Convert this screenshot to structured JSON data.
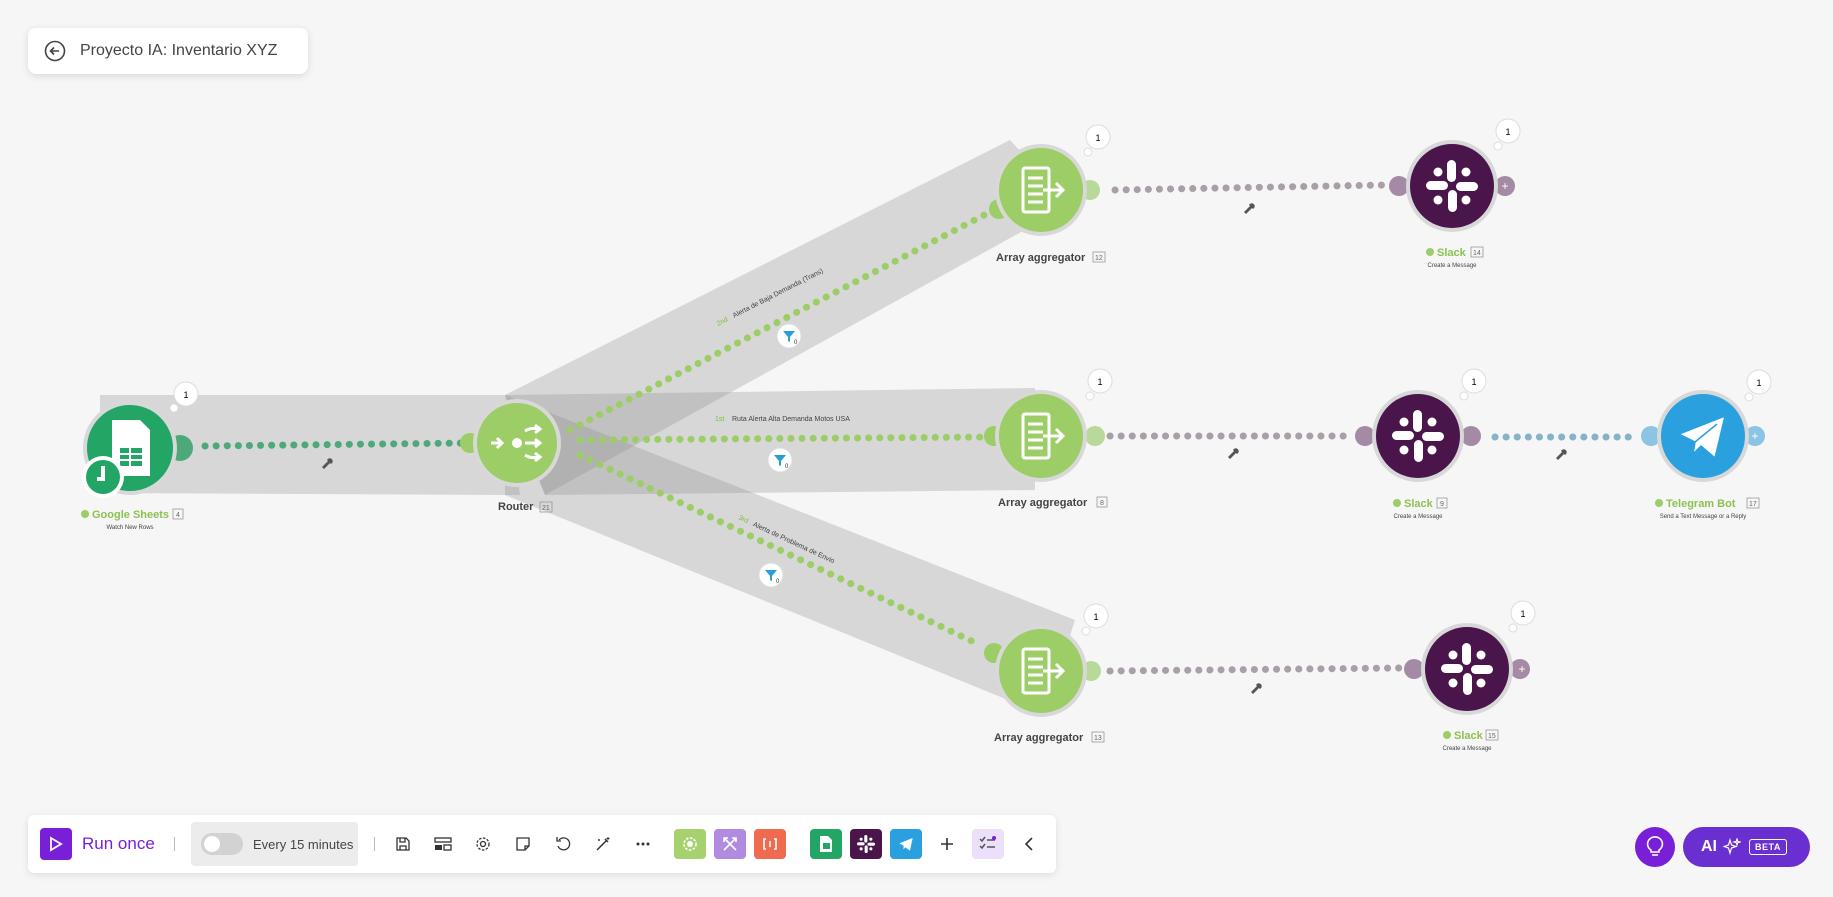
{
  "header": {
    "title": "Proyecto IA: Inventario XYZ"
  },
  "modules": {
    "sheets": {
      "name": "Google Sheets",
      "id": "4",
      "action": "Watch New Rows",
      "ops": "1"
    },
    "router": {
      "name": "Router",
      "id": "21"
    },
    "agg_top": {
      "name": "Array aggregator",
      "id": "12",
      "ops": "1"
    },
    "agg_mid": {
      "name": "Array aggregator",
      "id": "8",
      "ops": "1"
    },
    "agg_bot": {
      "name": "Array aggregator",
      "id": "13",
      "ops": "1"
    },
    "slack_top": {
      "name": "Slack",
      "id": "14",
      "action": "Create a Message",
      "ops": "1"
    },
    "slack_mid": {
      "name": "Slack",
      "id": "9",
      "action": "Create a Message",
      "ops": "1"
    },
    "slack_bot": {
      "name": "Slack",
      "id": "15",
      "action": "Create a Message",
      "ops": "1"
    },
    "telegram": {
      "name": "Telegram Bot",
      "id": "17",
      "action": "Send a Text Message or a Reply",
      "ops": "1"
    }
  },
  "routes": {
    "top": {
      "order": "2nd",
      "label": "Alerta de Baja Demanda (Trans)",
      "filter_count": "0"
    },
    "mid": {
      "order": "1st",
      "label": "Ruta Alerta Alta Demanda Motos USA",
      "filter_count": "0"
    },
    "bot": {
      "order": "3rd",
      "label": "Alerta de Problema de Envio",
      "filter_count": "0"
    }
  },
  "toolbar": {
    "run_label": "Run once",
    "schedule_label": "Every 15 minutes",
    "schedule_enabled": false
  },
  "ai": {
    "label": "AI",
    "badge": "BETA"
  },
  "colors": {
    "accent": "#7a1fd8",
    "tools": "#a6d16f",
    "sheets": "#22a565",
    "slack": "#4a154b",
    "telegram": "#2aa1de",
    "flow": "#e05a44",
    "ai": "#6a2fd0"
  },
  "icons": [
    "back-icon",
    "play-icon",
    "save-icon",
    "layout-icon",
    "gear-icon",
    "note-icon",
    "undo-icon",
    "magic-wand-icon",
    "more-icon",
    "tools-icon",
    "flow-control-icon",
    "text-parser-icon",
    "google-sheets-icon",
    "slack-icon",
    "telegram-icon",
    "plus-icon",
    "checklist-icon",
    "chevron-left-icon",
    "lightbulb-icon",
    "sparkles-icon",
    "filter-icon",
    "wrench-icon",
    "clock-icon"
  ]
}
